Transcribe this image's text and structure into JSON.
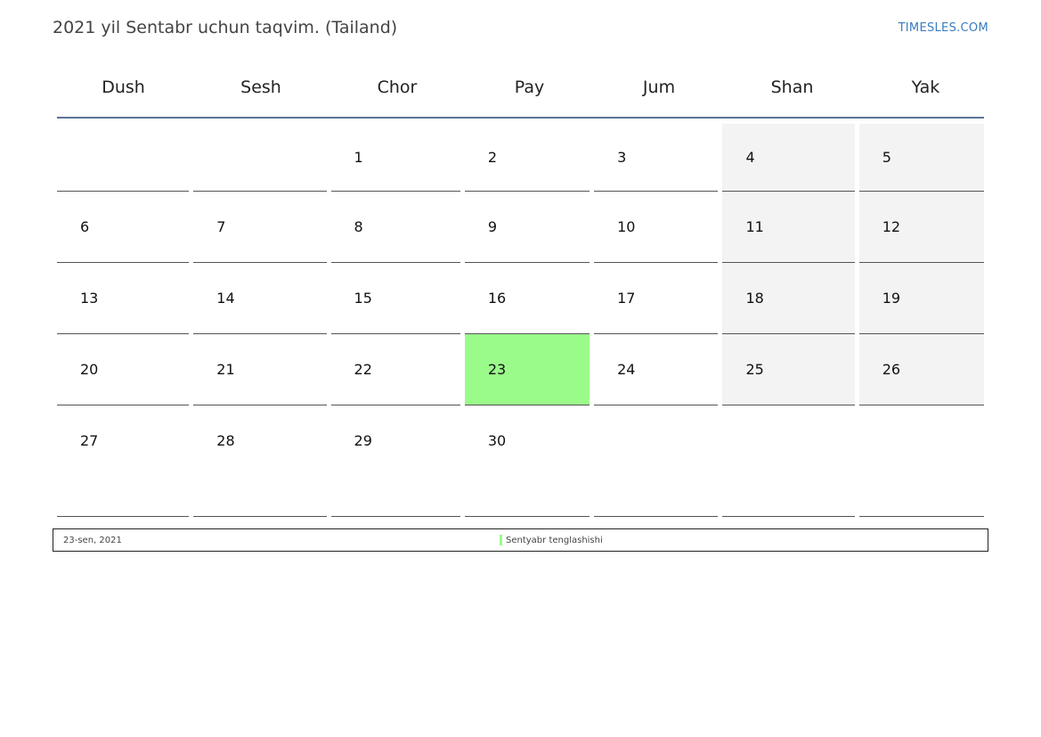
{
  "header": {
    "title": "2021 yil Sentabr uchun taqvim. (Tailand)",
    "brand": "TIMESLES.COM"
  },
  "calendar": {
    "weekdays": [
      "Dush",
      "Sesh",
      "Chor",
      "Pay",
      "Jum",
      "Shan",
      "Yak"
    ],
    "weeks": [
      [
        "",
        "",
        "1",
        "2",
        "3",
        "4",
        "5"
      ],
      [
        "6",
        "7",
        "8",
        "9",
        "10",
        "11",
        "12"
      ],
      [
        "13",
        "14",
        "15",
        "16",
        "17",
        "18",
        "19"
      ],
      [
        "20",
        "21",
        "22",
        "23",
        "24",
        "25",
        "26"
      ],
      [
        "27",
        "28",
        "29",
        "30",
        "",
        "",
        ""
      ]
    ],
    "highlighted_day": "23",
    "highlight_color": "#9afb8a",
    "weekend_color": "#f3f3f3"
  },
  "legend": {
    "date": "23-sen, 2021",
    "event": "Sentyabr tenglashishi"
  }
}
